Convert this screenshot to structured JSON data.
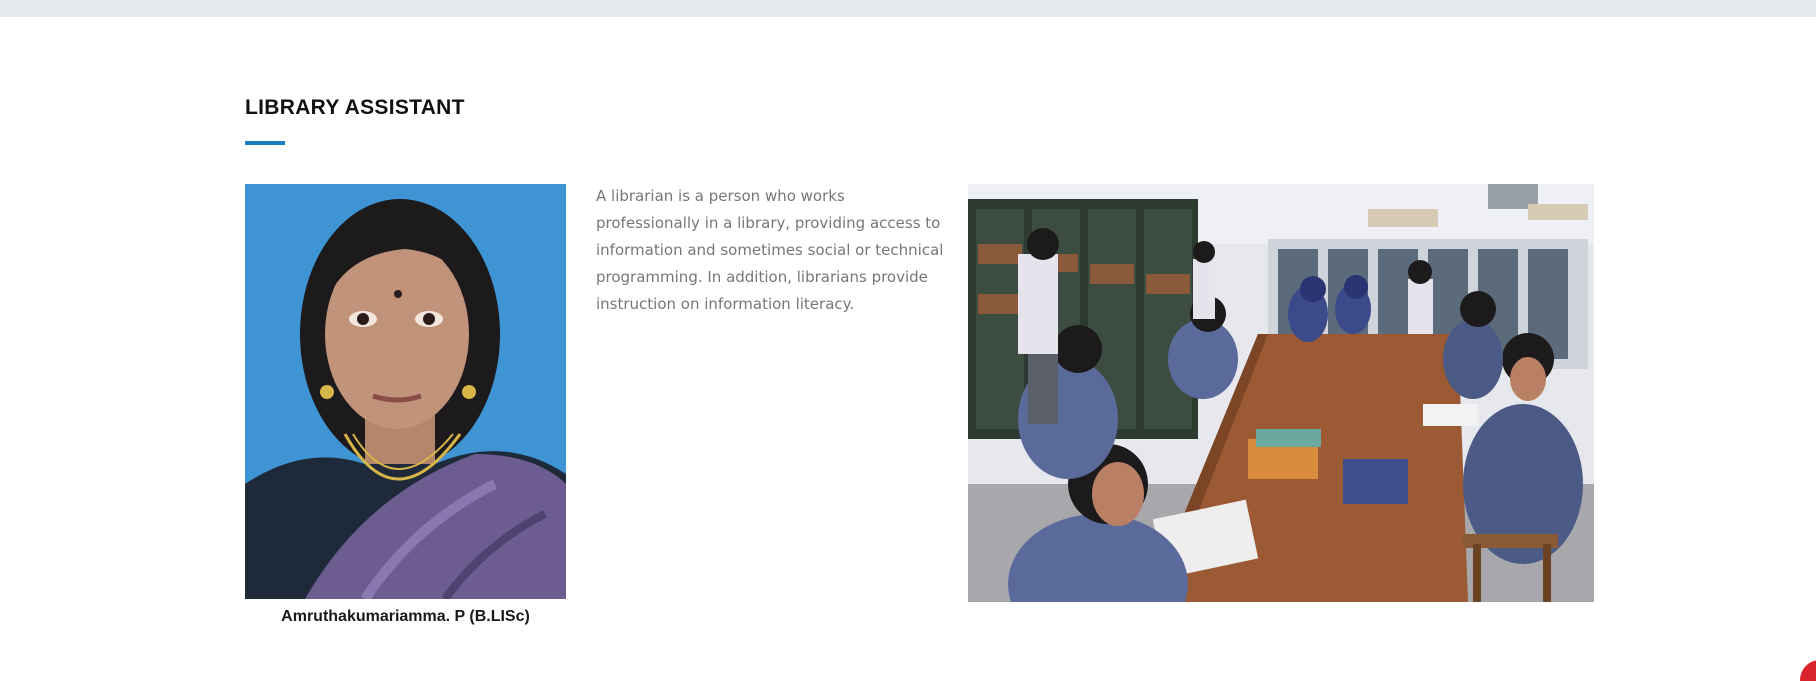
{
  "section": {
    "title": "LIBRARY ASSISTANT",
    "accent_color": "#1a7fc1"
  },
  "staff": {
    "name": "Amruthakumariamma. P (B.LISc)",
    "photo_icon": "portrait-photo"
  },
  "description": "A librarian is a person who works professionally in a library, providing access to information and sometimes social or technical programming. In addition, librarians provide instruction on information literacy.",
  "library_image": {
    "icon": "library-reading-room-photo"
  },
  "colors": {
    "top_bar": "#e8ebee",
    "text_body": "#777777",
    "corner_badge": "#d8232a"
  }
}
